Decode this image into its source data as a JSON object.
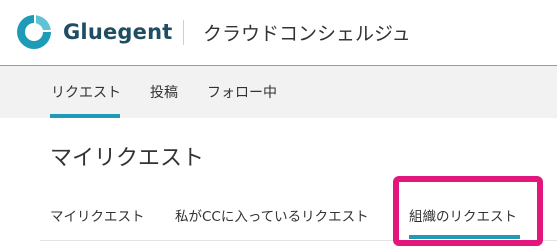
{
  "header": {
    "logo_text": "Gluegent",
    "logo_icon": "gluegent-logo-icon",
    "service_title": "クラウドコンシェルジュ"
  },
  "nav": {
    "items": [
      {
        "label": "リクエスト",
        "active": true
      },
      {
        "label": "投稿",
        "active": false
      },
      {
        "label": "フォロー中",
        "active": false
      }
    ]
  },
  "page": {
    "title": "マイリクエスト"
  },
  "subtabs": {
    "items": [
      {
        "label": "マイリクエスト",
        "active": false
      },
      {
        "label": "私がCCに入っているリクエスト",
        "active": false
      },
      {
        "label": "組織のリクエスト",
        "active": true
      }
    ]
  },
  "colors": {
    "accent": "#1e9bb6",
    "highlight": "#e2177d",
    "logo_text": "#1f4e63",
    "nav_bg": "#f2f2f2"
  }
}
